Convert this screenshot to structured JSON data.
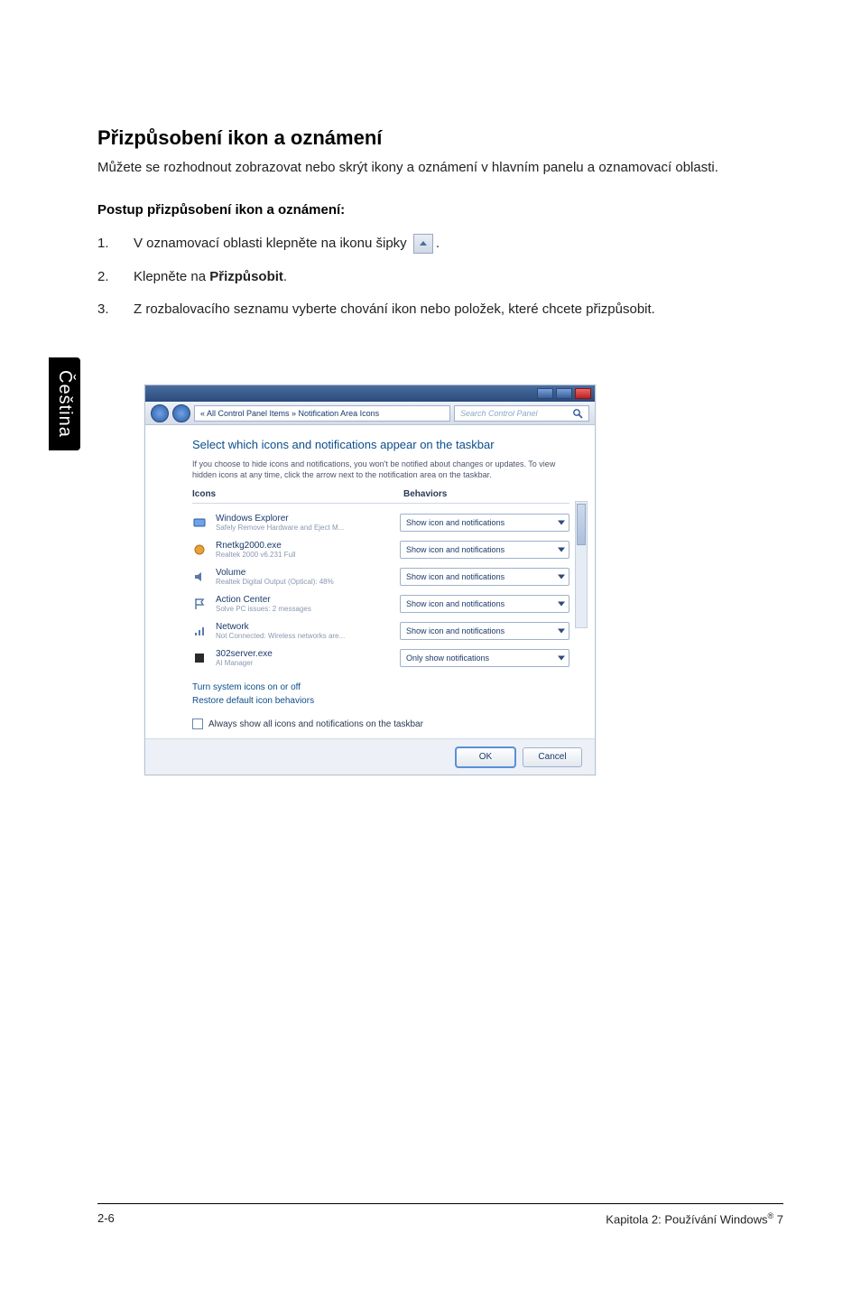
{
  "sideTab": "Čeština",
  "section": {
    "title": "Přizpůsobení ikon a oznámení",
    "intro": "Můžete se rozhodnout zobrazovat nebo skrýt ikony a oznámení v hlavním panelu a oznamovací oblasti.",
    "subheading": "Postup přizpůsobení ikon a oznámení:",
    "steps": {
      "s1_a": "V oznamovací oblasti klepněte na ikonu šipky ",
      "s1_b": ".",
      "s2_a": "Klepněte na ",
      "s2_bold": "Přizpůsobit",
      "s2_b": ".",
      "s3": "Z rozbalovacího seznamu vyberte chování ikon nebo položek, které chcete přizpůsobit."
    }
  },
  "shot": {
    "breadcrumb": "« All Control Panel Items » Notification Area Icons",
    "searchPlaceholder": "Search Control Panel",
    "title": "Select which icons and notifications appear on the taskbar",
    "desc": "If you choose to hide icons and notifications, you won't be notified about changes or updates. To view hidden icons at any time, click the arrow next to the notification area on the taskbar.",
    "colIcons": "Icons",
    "colBehaviors": "Behaviors",
    "rows": [
      {
        "name": "Windows Explorer",
        "sub": "Safely Remove Hardware and Eject M...",
        "behavior": "Show icon and notifications"
      },
      {
        "name": "Rnetkg2000.exe",
        "sub": "Realtek 2000 v6.231 Full",
        "behavior": "Show icon and notifications"
      },
      {
        "name": "Volume",
        "sub": "Realtek Digital Output (Optical): 48%",
        "behavior": "Show icon and notifications"
      },
      {
        "name": "Action Center",
        "sub": "Solve PC issues: 2 messages",
        "behavior": "Show icon and notifications"
      },
      {
        "name": "Network",
        "sub": "Not Connected: Wireless networks are...",
        "behavior": "Show icon and notifications"
      },
      {
        "name": "302server.exe",
        "sub": "AI Manager",
        "behavior": "Only show notifications"
      }
    ],
    "link1": "Turn system icons on or off",
    "link2": "Restore default icon behaviors",
    "checkbox": "Always show all icons and notifications on the taskbar",
    "ok": "OK",
    "cancel": "Cancel"
  },
  "footer": {
    "left": "2-6",
    "right_a": "Kapitola 2: Používání Windows",
    "right_sup": "®",
    "right_b": " 7"
  }
}
